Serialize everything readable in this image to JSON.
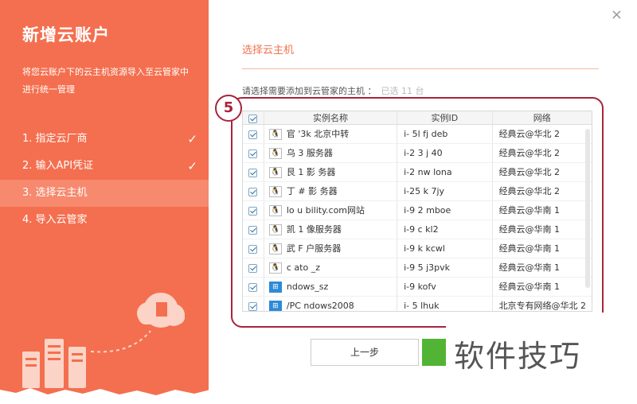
{
  "sidebar": {
    "title": "新增云账户",
    "description": "将您云账户下的云主机资源导入至云管家中进行统一管理",
    "steps": [
      {
        "label": "1. 指定云厂商",
        "done": true
      },
      {
        "label": "2. 输入API凭证",
        "done": true
      },
      {
        "label": "3. 选择云主机",
        "active": true
      },
      {
        "label": "4. 导入云管家"
      }
    ],
    "check_glyph": "✓"
  },
  "main": {
    "close_glyph": "×",
    "section_title": "选择云主机",
    "prompt": "请选择需要添加到云管家的主机 ：",
    "selected_count": "已选 11 台",
    "annotation_number": "5",
    "columns": {
      "name": "实例名称",
      "id": "实例ID",
      "network": "网络"
    },
    "rows": [
      {
        "os": "linux",
        "name": "官 '3k 北京中转",
        "id": "i- 5l fj deb",
        "network": "经典云@华北 2"
      },
      {
        "os": "linux",
        "name": "乌 3 服务器",
        "id": "i-2 3 j 40",
        "network": "经典云@华北 2"
      },
      {
        "os": "linux",
        "name": "艮 1 影 务器",
        "id": "i-2 nw lona",
        "network": "经典云@华北 2"
      },
      {
        "os": "linux",
        "name": "丁 # 影 务器",
        "id": "i-25 k 7jy",
        "network": "经典云@华北 2"
      },
      {
        "os": "linux",
        "name": "lo u bility.com网站",
        "id": "i-9 2 mboe",
        "network": "经典云@华南 1"
      },
      {
        "os": "linux",
        "name": "凯 1 像服务器",
        "id": "i-9 c kl2",
        "network": "经典云@华南 1"
      },
      {
        "os": "linux",
        "name": "武 F 户服务器",
        "id": "i-9 k kcwl",
        "network": "经典云@华南 1"
      },
      {
        "os": "linux",
        "name": "c ato _z",
        "id": "i-9 5 j3pvk",
        "network": "经典云@华南 1"
      },
      {
        "os": "windows",
        "name": "ndows_sz",
        "id": "i-9 kofv",
        "network": "经典云@华南 1"
      },
      {
        "os": "windows",
        "name": "/PC ndows2008",
        "id": "i- 5 lhuk",
        "network": "北京专有网络@华北 2"
      }
    ],
    "prev_button": "上一步"
  },
  "watermark": "软件技巧",
  "colors": {
    "accent": "#f46f4f",
    "annotation": "#a8243b",
    "next_button": "#52b434"
  }
}
